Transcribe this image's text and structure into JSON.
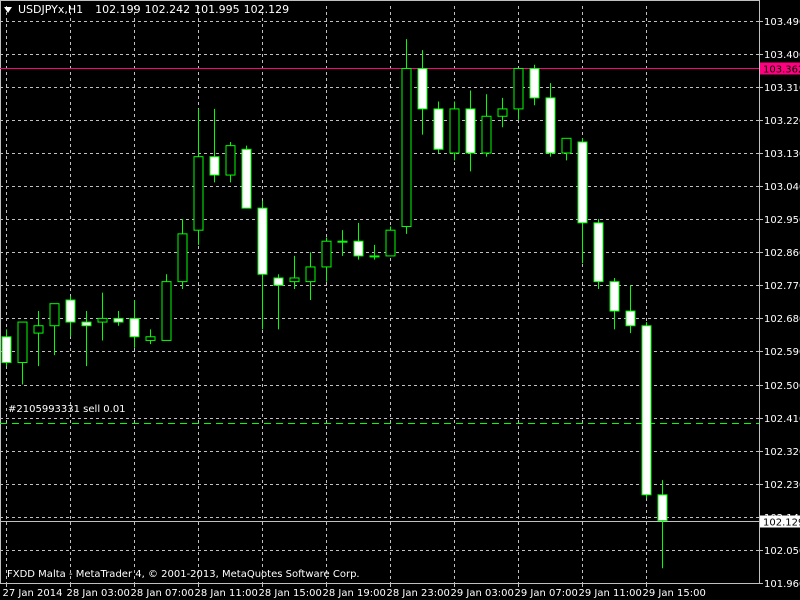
{
  "header": {
    "symbol": "USDJPYx,H1",
    "open": "102.199",
    "high": "102.242",
    "low": "101.995",
    "close": "102.129"
  },
  "footer": {
    "text": "FXDD Malta - MetaTrader 4, © 2001-2013, MetaQuotes Software Corp."
  },
  "order": {
    "label": "#2105993331 sell 0.01",
    "price": 102.395
  },
  "colors": {
    "background": "#000000",
    "grid": "#c0c0c0",
    "bull": "#000000",
    "bear": "#ffffff",
    "wick": "#00ff00",
    "hline": "#ff0080",
    "order": "#00ff00"
  },
  "chart_data": {
    "type": "candlestick",
    "ylim": [
      101.96,
      103.53
    ],
    "y_ticks": [
      "103.490",
      "103.400",
      "103.310",
      "103.220",
      "103.130",
      "103.040",
      "102.950",
      "102.860",
      "102.770",
      "102.680",
      "102.590",
      "102.500",
      "102.410",
      "102.320",
      "102.230",
      "102.140",
      "102.050",
      "101.960"
    ],
    "x_tick_labels": [
      "27 Jan 2014",
      "28 Jan 03:00",
      "28 Jan 07:00",
      "28 Jan 11:00",
      "28 Jan 15:00",
      "28 Jan 19:00",
      "28 Jan 23:00",
      "29 Jan 03:00",
      "29 Jan 07:00",
      "29 Jan 11:00",
      "29 Jan 15:00"
    ],
    "high_line": 103.362,
    "high_line_label": "103.362",
    "current_price": 102.129,
    "current_price_label": "102.129",
    "grid": true,
    "candles": [
      {
        "o": 102.63,
        "h": 102.65,
        "l": 102.55,
        "c": 102.56
      },
      {
        "o": 102.56,
        "h": 102.67,
        "l": 102.5,
        "c": 102.67
      },
      {
        "o": 102.64,
        "h": 102.7,
        "l": 102.55,
        "c": 102.66
      },
      {
        "o": 102.66,
        "h": 102.72,
        "l": 102.58,
        "c": 102.72
      },
      {
        "o": 102.73,
        "h": 102.74,
        "l": 102.63,
        "c": 102.67
      },
      {
        "o": 102.67,
        "h": 102.7,
        "l": 102.55,
        "c": 102.66
      },
      {
        "o": 102.67,
        "h": 102.75,
        "l": 102.62,
        "c": 102.68
      },
      {
        "o": 102.68,
        "h": 102.7,
        "l": 102.66,
        "c": 102.67
      },
      {
        "o": 102.68,
        "h": 102.73,
        "l": 102.6,
        "c": 102.63
      },
      {
        "o": 102.62,
        "h": 102.65,
        "l": 102.61,
        "c": 102.63
      },
      {
        "o": 102.62,
        "h": 102.8,
        "l": 102.62,
        "c": 102.78
      },
      {
        "o": 102.78,
        "h": 102.95,
        "l": 102.76,
        "c": 102.91
      },
      {
        "o": 102.92,
        "h": 103.25,
        "l": 102.88,
        "c": 103.12
      },
      {
        "o": 103.12,
        "h": 103.25,
        "l": 103.05,
        "c": 103.07
      },
      {
        "o": 103.07,
        "h": 103.16,
        "l": 103.05,
        "c": 103.15
      },
      {
        "o": 103.14,
        "h": 103.15,
        "l": 102.98,
        "c": 102.98
      },
      {
        "o": 102.98,
        "h": 103.0,
        "l": 102.65,
        "c": 102.8
      },
      {
        "o": 102.79,
        "h": 102.8,
        "l": 102.65,
        "c": 102.77
      },
      {
        "o": 102.78,
        "h": 102.85,
        "l": 102.76,
        "c": 102.79
      },
      {
        "o": 102.78,
        "h": 102.86,
        "l": 102.73,
        "c": 102.82
      },
      {
        "o": 102.82,
        "h": 102.9,
        "l": 102.78,
        "c": 102.89
      },
      {
        "o": 102.89,
        "h": 102.92,
        "l": 102.85,
        "c": 102.89
      },
      {
        "o": 102.89,
        "h": 102.94,
        "l": 102.84,
        "c": 102.85
      },
      {
        "o": 102.85,
        "h": 102.88,
        "l": 102.84,
        "c": 102.85
      },
      {
        "o": 102.85,
        "h": 102.93,
        "l": 102.85,
        "c": 102.92
      },
      {
        "o": 102.93,
        "h": 103.44,
        "l": 102.91,
        "c": 103.36
      },
      {
        "o": 103.36,
        "h": 103.41,
        "l": 103.18,
        "c": 103.25
      },
      {
        "o": 103.25,
        "h": 103.27,
        "l": 103.13,
        "c": 103.14
      },
      {
        "o": 103.13,
        "h": 103.27,
        "l": 103.11,
        "c": 103.25
      },
      {
        "o": 103.25,
        "h": 103.3,
        "l": 103.08,
        "c": 103.13
      },
      {
        "o": 103.13,
        "h": 103.29,
        "l": 103.12,
        "c": 103.23
      },
      {
        "o": 103.23,
        "h": 103.28,
        "l": 103.2,
        "c": 103.25
      },
      {
        "o": 103.25,
        "h": 103.36,
        "l": 103.22,
        "c": 103.36
      },
      {
        "o": 103.36,
        "h": 103.37,
        "l": 103.26,
        "c": 103.28
      },
      {
        "o": 103.28,
        "h": 103.32,
        "l": 103.12,
        "c": 103.13
      },
      {
        "o": 103.13,
        "h": 103.17,
        "l": 103.11,
        "c": 103.17
      },
      {
        "o": 103.16,
        "h": 103.17,
        "l": 102.83,
        "c": 102.94
      },
      {
        "o": 102.94,
        "h": 102.95,
        "l": 102.76,
        "c": 102.78
      },
      {
        "o": 102.78,
        "h": 102.79,
        "l": 102.65,
        "c": 102.7
      },
      {
        "o": 102.7,
        "h": 102.77,
        "l": 102.64,
        "c": 102.66
      },
      {
        "o": 102.66,
        "h": 102.67,
        "l": 102.19,
        "c": 102.2
      },
      {
        "o": 102.2,
        "h": 102.24,
        "l": 102.0,
        "c": 102.13
      }
    ]
  }
}
